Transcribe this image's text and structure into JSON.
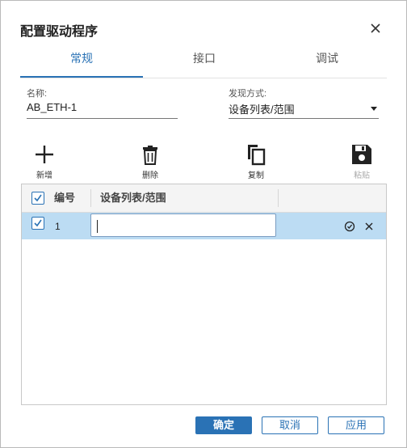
{
  "dialog": {
    "title": "配置驱动程序"
  },
  "tabs": [
    {
      "label": "常规",
      "active": true
    },
    {
      "label": "接口",
      "active": false
    },
    {
      "label": "调试",
      "active": false
    }
  ],
  "form": {
    "name_label": "名称:",
    "name_value": "AB_ETH-1",
    "discovery_label": "发现方式:",
    "discovery_value": "设备列表/范围"
  },
  "toolbar": {
    "add_label": "新增",
    "delete_label": "删除",
    "copy_label": "复制",
    "paste_label": "粘贴",
    "paste_disabled": true
  },
  "table": {
    "columns": [
      "编号",
      "设备列表/范围"
    ],
    "header_checked": true,
    "rows": [
      {
        "checked": true,
        "number": "1",
        "value": "",
        "selected": true,
        "editing": true
      }
    ]
  },
  "footer": {
    "ok_label": "确定",
    "cancel_label": "取消",
    "apply_label": "应用"
  },
  "colors": {
    "accent": "#2a72b5",
    "row_selected": "#bcdcf3"
  }
}
